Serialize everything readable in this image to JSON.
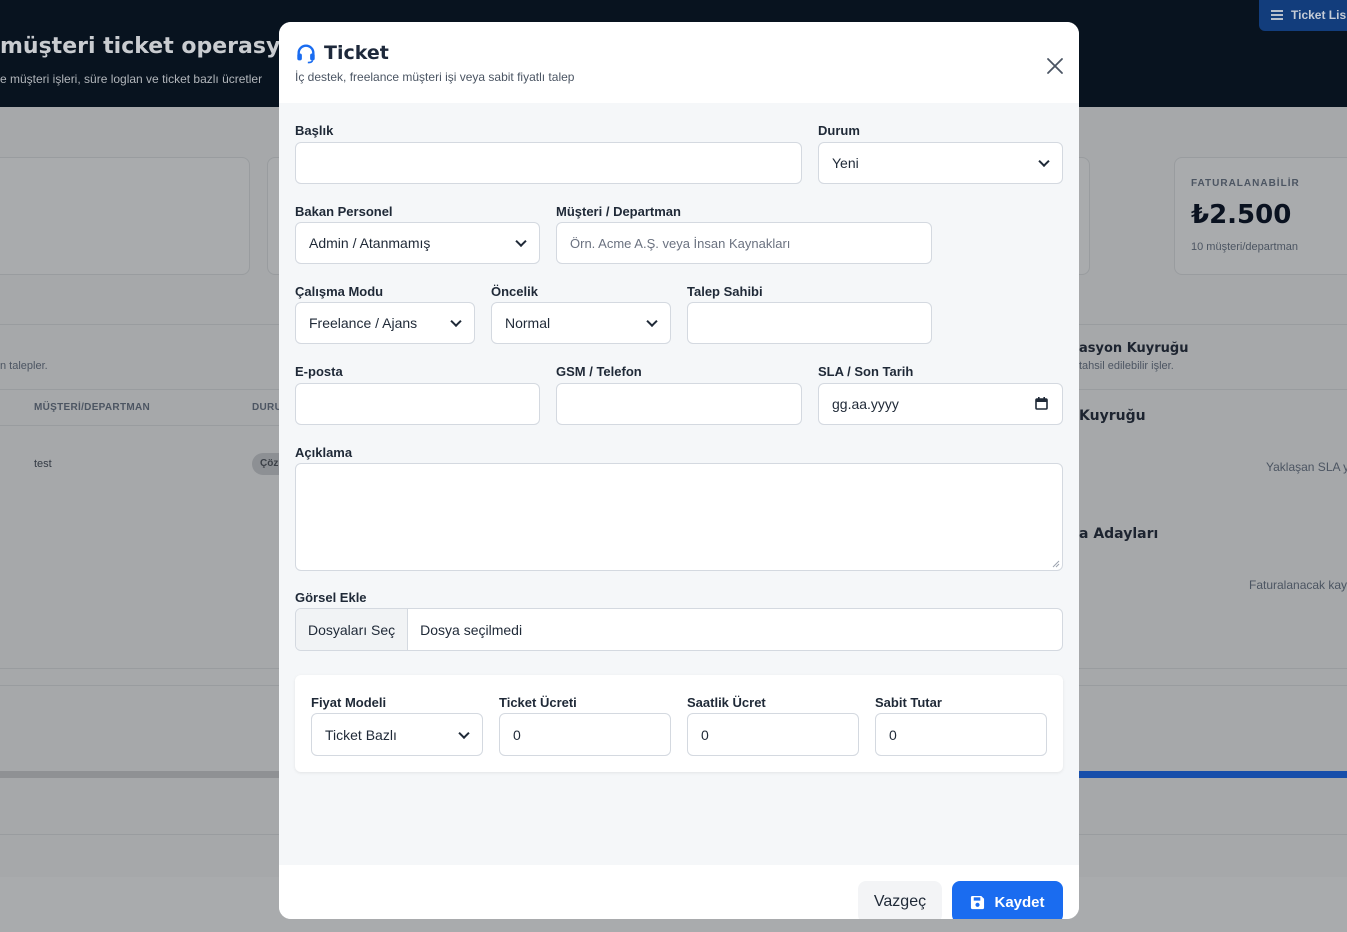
{
  "background": {
    "title": "müşteri ticket operasyonu",
    "subtitle": "e müşteri işleri, süre loglan ve ticket bazlı ücretler",
    "top_button": "Ticket Lis",
    "card": {
      "label": "FATURALANABİLİR",
      "value": "₺2.500",
      "sub": "10 müşteri/departman"
    },
    "left_note": "n talepler.",
    "table_header_customer": "MÜŞTERİ/DEPARTMAN",
    "table_header_status": "DURU",
    "row_customer": "test",
    "row_badge": "Çöz",
    "queue_title": "asyon Kuyruğu",
    "queue_sub": "tahsil edilebilir işler.",
    "sla_title": "Kuyruğu",
    "sla_empty": "Yaklaşan SLA y",
    "invoice_title": "a Adayları",
    "invoice_empty": "Faturalanacak kay"
  },
  "modal": {
    "title": "Ticket",
    "subtitle": "İç destek, freelance müşteri işi veya sabit fiyatlı talep",
    "fields": {
      "baslik": {
        "label": "Başlık",
        "value": ""
      },
      "durum": {
        "label": "Durum",
        "value": "Yeni"
      },
      "bakan_personel": {
        "label": "Bakan Personel",
        "value": "Admin / Atanmamış"
      },
      "musteri": {
        "label": "Müşteri / Departman",
        "placeholder": "Örn. Acme A.Ş. veya İnsan Kaynakları"
      },
      "calisma_modu": {
        "label": "Çalışma Modu",
        "value": "Freelance / Ajans"
      },
      "oncelik": {
        "label": "Öncelik",
        "value": "Normal"
      },
      "talep_sahibi": {
        "label": "Talep Sahibi",
        "value": ""
      },
      "eposta": {
        "label": "E-posta",
        "value": ""
      },
      "gsm": {
        "label": "GSM / Telefon",
        "value": ""
      },
      "sla": {
        "label": "SLA / Son Tarih",
        "placeholder": "gg.aa.yyyy"
      },
      "aciklama": {
        "label": "Açıklama",
        "value": ""
      },
      "gorsel": {
        "label": "Görsel Ekle",
        "button": "Dosyaları Seç",
        "status": "Dosya seçilmedi"
      }
    },
    "pricing": {
      "model": {
        "label": "Fiyat Modeli",
        "value": "Ticket Bazlı"
      },
      "ticket_fee": {
        "label": "Ticket Ücreti",
        "value": "0"
      },
      "hourly_fee": {
        "label": "Saatlik Ücret",
        "value": "0"
      },
      "fixed_amount": {
        "label": "Sabit Tutar",
        "value": "0"
      }
    },
    "buttons": {
      "cancel": "Vazgeç",
      "save": "Kaydet"
    }
  },
  "colors": {
    "primary": "#1a6cf0",
    "overlay": "#a6a8aa",
    "header_bg": "#08131f"
  },
  "icons": [
    "headset-icon",
    "close-icon",
    "chevron-down-icon",
    "calendar-icon",
    "save-icon",
    "list-icon"
  ]
}
